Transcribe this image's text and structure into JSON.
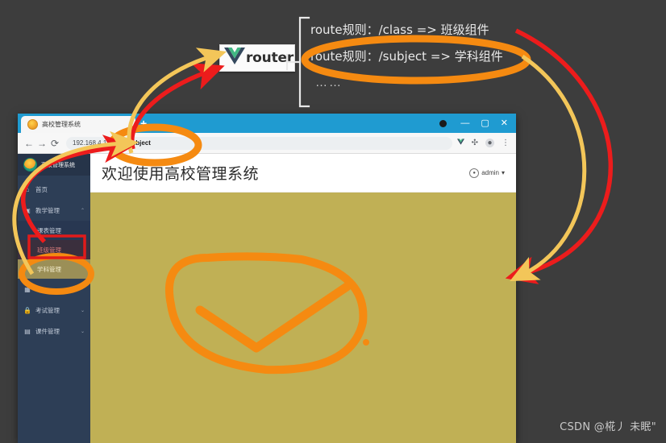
{
  "annotation": {
    "route_rules": {
      "line1_prefix": "route",
      "line1": "route规则：/class => 班级组件",
      "line2": "route规则：/subject => 学科组件",
      "ellipsis": "……"
    },
    "vue_router": {
      "label": "router",
      "logo_name": "vue-logo"
    },
    "colors": {
      "orange_marker": "#f58a11",
      "red_arrow": "#ec1c1c",
      "yellow_arrow": "#f3c659",
      "page_background": "#3d3d3d",
      "sidebar": "#2d3e56",
      "content_canvas": "#c0b055",
      "titlebar": "#1f9bd1"
    }
  },
  "browser": {
    "tab": {
      "title": "高校管理系统",
      "new_tab_label": "+"
    },
    "window_controls": {
      "minimize": "—",
      "maximize": "▢",
      "close": "✕"
    },
    "toolbar": {
      "back": "←",
      "forward": "→",
      "reload": "⟳",
      "url_host": "192.168.4.17:8080",
      "url_path": "/subject",
      "url_full": "192.168.4.17:8080/subject",
      "icons": [
        "vue-devtools-icon",
        "extensions-icon",
        "profile-icon",
        "menu-icon"
      ]
    }
  },
  "app": {
    "brand": "高校管理系统",
    "header": {
      "title": "欢迎使用高校管理系统",
      "user": "admin",
      "user_caret": "▾"
    },
    "sidebar": [
      {
        "label": "首页",
        "icon": "home-icon",
        "caret": ""
      },
      {
        "label": "教学管理",
        "icon": "monitor-icon",
        "caret": "⌃"
      },
      {
        "label": "课表管理",
        "icon": "",
        "caret": "",
        "sub": true
      },
      {
        "label": "班级管理",
        "icon": "",
        "caret": "",
        "sub": true,
        "state": "red"
      },
      {
        "label": "学科管理",
        "icon": "",
        "caret": "",
        "sub": true,
        "state": "olive"
      },
      {
        "label": "考试管理",
        "icon": "lock-icon",
        "caret": "⌄"
      },
      {
        "label": "课件管理",
        "icon": "file-icon",
        "caret": "⌄"
      }
    ]
  },
  "watermark": "CSDN @椛丿 未眠\""
}
